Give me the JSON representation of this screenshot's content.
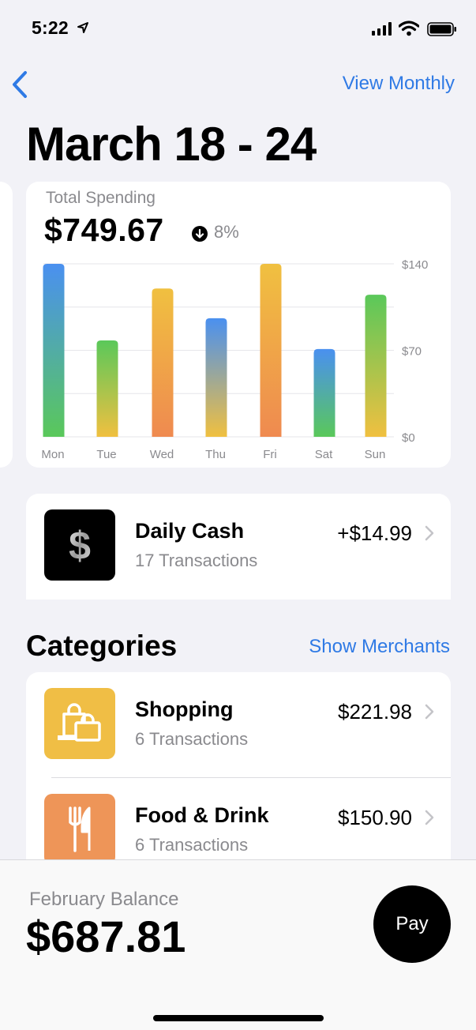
{
  "status_bar": {
    "time": "5:22"
  },
  "nav": {
    "view_monthly_label": "View Monthly"
  },
  "page_title": "March 18 - 24",
  "spending": {
    "label": "Total Spending",
    "total": "$749.67",
    "change_pct": "8%"
  },
  "chart_data": {
    "type": "bar",
    "categories": [
      "Mon",
      "Tue",
      "Wed",
      "Thu",
      "Fri",
      "Sat",
      "Sun"
    ],
    "values": [
      140,
      78,
      120,
      96,
      140,
      71,
      115
    ],
    "y_ticks": [
      "$140",
      "$70",
      "$0"
    ],
    "y_tick_values": [
      140,
      70,
      0
    ],
    "ylim": [
      0,
      140
    ],
    "grid": true,
    "bar_gradients": [
      [
        "#4a90f0",
        "#5ac85a"
      ],
      [
        "#5ac85a",
        "#f0c040"
      ],
      [
        "#f0c040",
        "#ef8a50"
      ],
      [
        "#4a90f0",
        "#f0c040"
      ],
      [
        "#f0c040",
        "#ef8a50"
      ],
      [
        "#4a90f0",
        "#5ac85a"
      ],
      [
        "#5ac85a",
        "#f0c040"
      ]
    ]
  },
  "daily_cash": {
    "title": "Daily Cash",
    "subtitle": "17 Transactions",
    "amount": "+$14.99",
    "icon_symbol": "$"
  },
  "categories": {
    "heading": "Categories",
    "show_merchants_label": "Show Merchants",
    "items": [
      {
        "name": "Shopping",
        "subtitle": "6 Transactions",
        "amount": "$221.98",
        "color": "#f0be45",
        "icon": "shopping-bags-icon"
      },
      {
        "name": "Food & Drink",
        "subtitle": "6 Transactions",
        "amount": "$150.90",
        "color": "#ee9558",
        "icon": "fork-knife-icon"
      }
    ]
  },
  "balance": {
    "label": "February Balance",
    "value": "$687.81",
    "pay_label": "Pay"
  },
  "colors": {
    "accent": "#2f7ae5",
    "background": "#f2f2f7"
  }
}
